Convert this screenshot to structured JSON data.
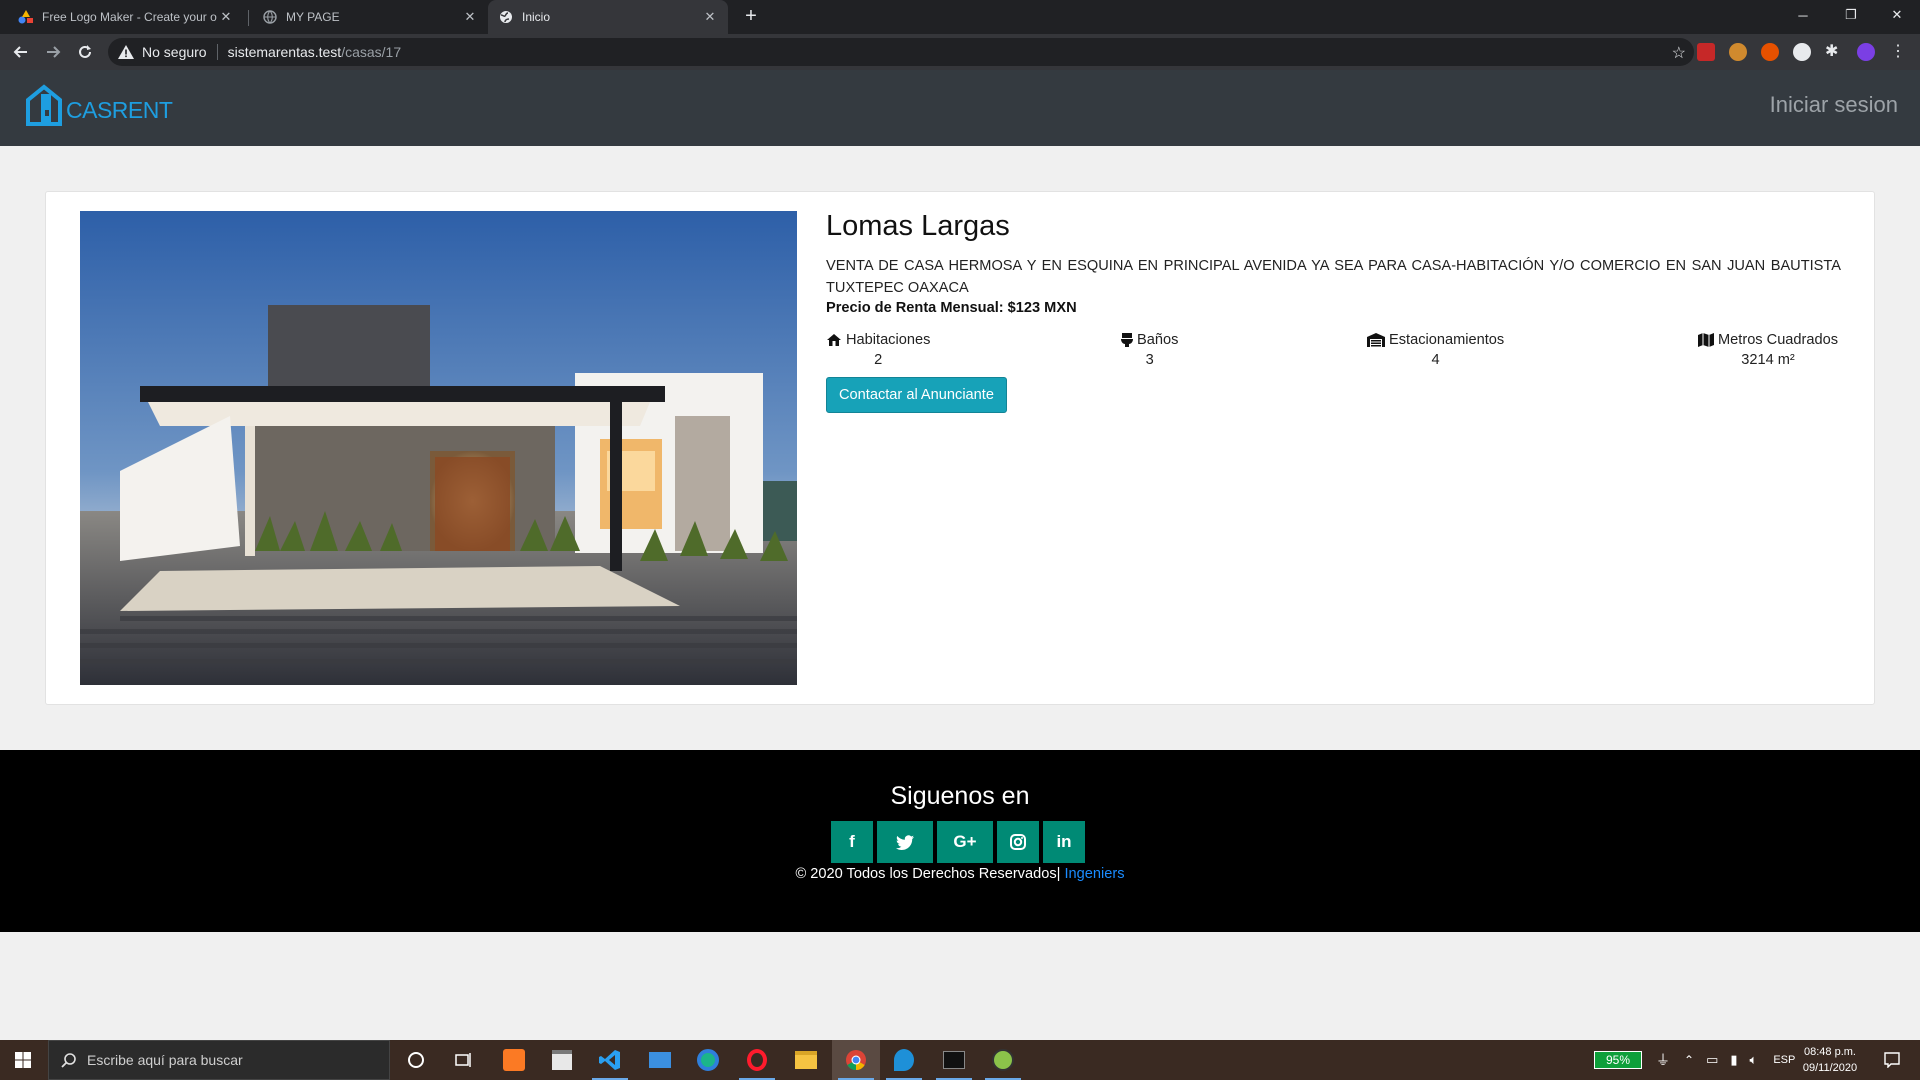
{
  "browser": {
    "tabs": [
      {
        "label": "Free Logo Maker - Create your o",
        "active": false
      },
      {
        "label": "MY PAGE",
        "active": false
      },
      {
        "label": "Inicio",
        "active": true
      }
    ],
    "security_label": "No seguro",
    "url_host": "sistemarentas.test",
    "url_path": "/casas/17"
  },
  "site": {
    "brand": "CASRENT",
    "login_link": "Iniciar sesion"
  },
  "property": {
    "title": "Lomas Largas",
    "description": "VENTA DE CASA HERMOSA Y EN ESQUINA EN PRINCIPAL AVENIDA YA SEA PARA CASA-HABITACIÓN Y/O COMERCIO EN SAN JUAN BAUTISTA TUXTEPEC OAXACA",
    "price_label": "Precio de Renta Mensual: $123 MXN",
    "features": [
      {
        "label": "Habitaciones",
        "value": "2",
        "icon": "house-icon"
      },
      {
        "label": "Baños",
        "value": "3",
        "icon": "toilet-icon"
      },
      {
        "label": "Estacionamientos",
        "value": "4",
        "icon": "garage-icon"
      },
      {
        "label": "Metros Cuadrados",
        "value": "3214 m²",
        "icon": "map-icon"
      }
    ],
    "contact_button": "Contactar al Anunciante"
  },
  "footer": {
    "title": "Siguenos en",
    "socials": [
      "f",
      "twitter",
      "G+",
      "instagram",
      "in"
    ],
    "copyright": "© 2020 Todos los Derechos Reservados|",
    "author": " Ingeniers"
  },
  "taskbar": {
    "search_placeholder": "Escribe aquí para buscar",
    "battery": "95%",
    "language": "ESP",
    "time": "08:48 p.m.",
    "date": "09/11/2020"
  },
  "colors": {
    "accent": "#17a2b8",
    "brand": "#1e9ee0",
    "social": "#008a75",
    "header": "#343a40"
  }
}
